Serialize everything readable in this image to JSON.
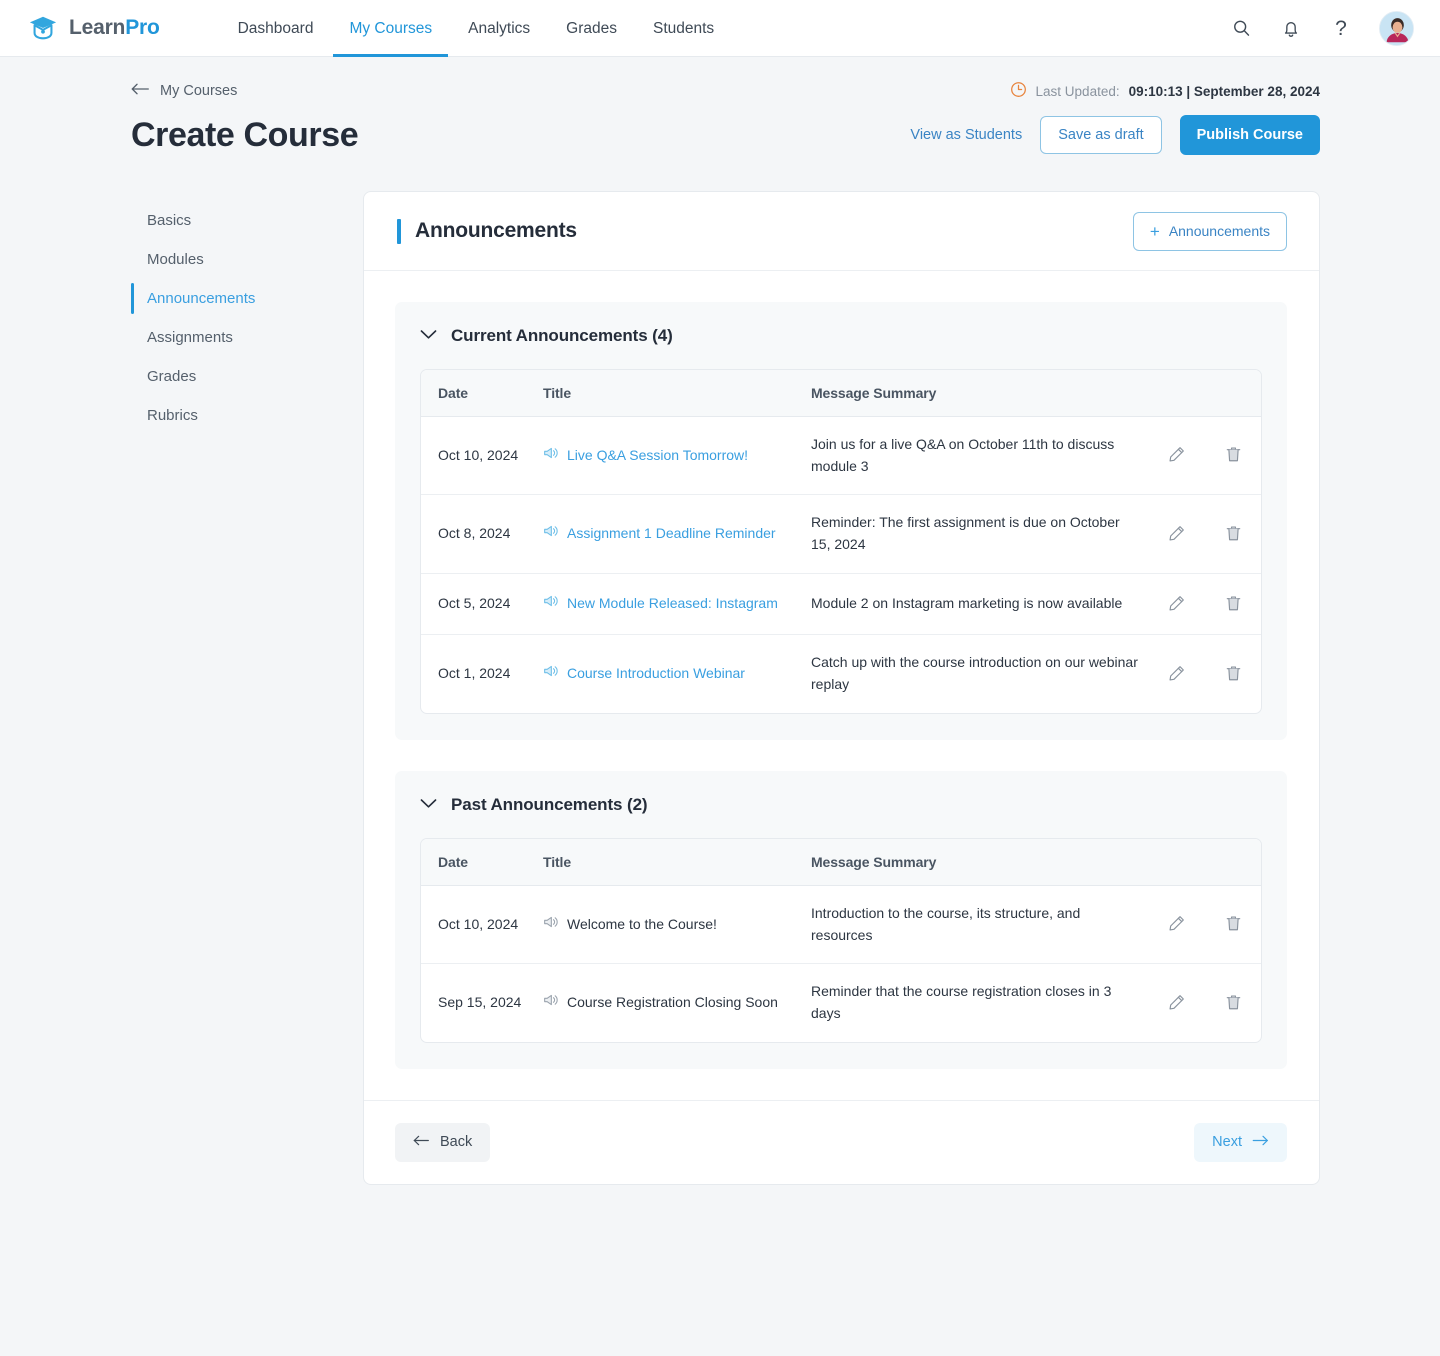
{
  "brand": {
    "name_part1": "Learn",
    "name_part2": "Pro",
    "logo_icon": "graduation-cap-icon"
  },
  "nav": {
    "tabs": [
      {
        "label": "Dashboard",
        "active": false
      },
      {
        "label": "My Courses",
        "active": true
      },
      {
        "label": "Analytics",
        "active": false
      },
      {
        "label": "Grades",
        "active": false
      },
      {
        "label": "Students",
        "active": false
      }
    ],
    "icons": [
      {
        "name": "search-icon"
      },
      {
        "name": "notification-bell-icon"
      },
      {
        "name": "help-question-icon",
        "glyph": "?"
      }
    ],
    "avatar": "user-avatar"
  },
  "header": {
    "breadcrumb": "My Courses",
    "back_arrow_icon": "arrow-left-icon",
    "title": "Create Course",
    "last_updated": {
      "clock_icon": "clock-icon",
      "label": "Last Updated:",
      "value": "09:10:13 |  September 28, 2024"
    },
    "actions": {
      "view_as_students": "View as Students",
      "save_as_draft": "Save as draft",
      "publish_course": "Publish Course"
    }
  },
  "sidebar": {
    "items": [
      {
        "label": "Basics",
        "active": false
      },
      {
        "label": "Modules",
        "active": false
      },
      {
        "label": "Announcements",
        "active": true
      },
      {
        "label": "Assignments",
        "active": false
      },
      {
        "label": "Grades",
        "active": false
      },
      {
        "label": "Rubrics",
        "active": false
      }
    ]
  },
  "main": {
    "card_title": "Announcements",
    "add_button": {
      "plus": "+",
      "label": "Announcements"
    },
    "columns": {
      "date": "Date",
      "title": "Title",
      "message": "Message Summary"
    },
    "sections": [
      {
        "heading": "Current Announcements (4)",
        "rows": [
          {
            "date": "Oct 10, 2024",
            "title": "Live Q&A Session Tomorrow!",
            "message": "Join us for a live Q&A on October 11th to discuss module 3",
            "link": true
          },
          {
            "date": "Oct 8, 2024",
            "title": "Assignment 1 Deadline Reminder",
            "message": "Reminder: The first assignment is due on October 15, 2024",
            "link": true
          },
          {
            "date": "Oct 5, 2024",
            "title": "New Module Released: Instagram",
            "message": "Module 2 on Instagram marketing is now available",
            "link": true
          },
          {
            "date": "Oct 1, 2024",
            "title": "Course Introduction Webinar",
            "message": "Catch up with the course introduction on our webinar replay",
            "link": true
          }
        ]
      },
      {
        "heading": "Past Announcements (2)",
        "rows": [
          {
            "date": "Oct 10, 2024",
            "title": "Welcome to the Course!",
            "message": "Introduction to the course, its structure, and resources",
            "link": false
          },
          {
            "date": "Sep 15, 2024",
            "title": "Course Registration Closing Soon",
            "message": "Reminder that the course registration closes in 3 days",
            "link": false
          }
        ]
      }
    ],
    "row_actions": {
      "edit_icon": "edit-pencil-icon",
      "delete_icon": "delete-trash-icon"
    },
    "announcement_icon": "megaphone-icon",
    "footer": {
      "back": "Back",
      "next": "Next"
    }
  },
  "colors": {
    "accent": "#2196d9",
    "link": "#3a9fe0",
    "page_bg": "#f4f6f8",
    "text_dark": "#252d3a",
    "clock": "#e8853f"
  }
}
